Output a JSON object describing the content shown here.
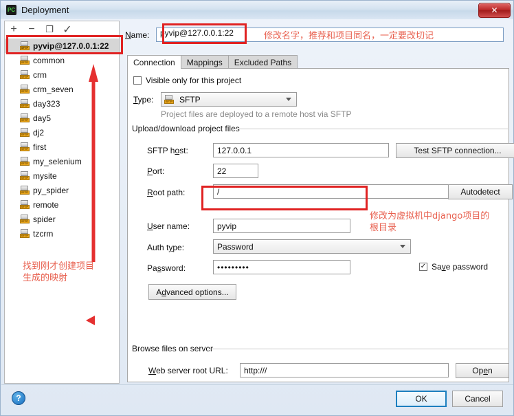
{
  "window": {
    "title": "Deployment",
    "app_icon": "pycharm-icon",
    "close_label": "✕"
  },
  "sidebar": {
    "toolbar": [
      {
        "name": "add-button",
        "glyph": "+"
      },
      {
        "name": "remove-button",
        "glyph": "−"
      },
      {
        "name": "copy-button",
        "glyph": "❐"
      },
      {
        "name": "set-default-button",
        "glyph": "✓"
      }
    ],
    "items": [
      {
        "label": "pyvip@127.0.0.1:22",
        "selected": true
      },
      {
        "label": "common",
        "selected": false
      },
      {
        "label": "crm",
        "selected": false
      },
      {
        "label": "crm_seven",
        "selected": false
      },
      {
        "label": "day323",
        "selected": false
      },
      {
        "label": "day5",
        "selected": false
      },
      {
        "label": "dj2",
        "selected": false
      },
      {
        "label": "first",
        "selected": false
      },
      {
        "label": "my_selenium",
        "selected": false
      },
      {
        "label": "mysite",
        "selected": false
      },
      {
        "label": "py_spider",
        "selected": false
      },
      {
        "label": "remote",
        "selected": false
      },
      {
        "label": "spider",
        "selected": false
      },
      {
        "label": "tzcrm",
        "selected": false
      }
    ],
    "icon_badge": "SFTP"
  },
  "panel": {
    "name_label": "Name:",
    "name_value": "pyvip@127.0.0.1:22",
    "tabs": [
      {
        "label": "Connection",
        "active": true
      },
      {
        "label": "Mappings",
        "active": false
      },
      {
        "label": "Excluded Paths",
        "active": false
      }
    ],
    "visible_only_label": "Visible only for this project",
    "visible_only_checked": false,
    "type_label": "Type:",
    "type_value": "SFTP",
    "type_hint": "Project files are deployed to a remote host via SFTP",
    "upload_group_title": "Upload/download project files",
    "sftp_host_label": "SFTP host:",
    "sftp_host_value": "127.0.0.1",
    "test_connection_label": "Test SFTP connection...",
    "port_label": "Port:",
    "port_value": "22",
    "root_path_label": "Root path:",
    "root_path_value": "/",
    "browse_icon": "folder-icon",
    "autodetect_label": "Autodetect",
    "user_name_label": "User name:",
    "user_name_value": "pyvip",
    "auth_type_label": "Auth type:",
    "auth_type_value": "Password",
    "password_label": "Password:",
    "password_value": "•••••••••",
    "save_password_label": "Save password",
    "save_password_checked": true,
    "advanced_options_label": "Advanced options...",
    "browse_group_title": "Browse files on server",
    "web_root_label": "Web server root URL:",
    "web_root_value": "http:///",
    "open_label": "Open"
  },
  "footer": {
    "help_glyph": "?",
    "ok_label": "OK",
    "cancel_label": "Cancel"
  },
  "annotations": {
    "name_note": "修改名字，推荐和项目同名，一定要改切记",
    "root_path_note_line1": "修改为虚拟机中django项目的",
    "root_path_note_line2": "根目录",
    "sidebar_note_line1": "找到刚才创建项目",
    "sidebar_note_line2": "生成的映射",
    "accent_color": "#e02222",
    "text_color": "#e8604f"
  }
}
